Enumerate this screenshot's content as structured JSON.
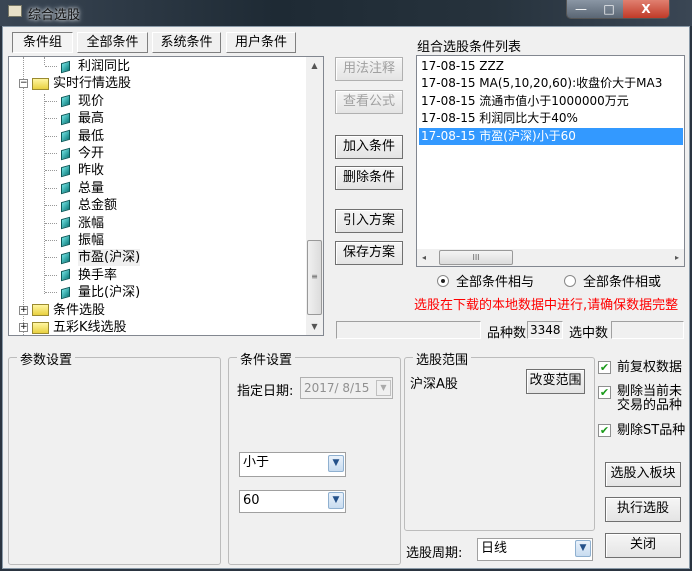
{
  "window": {
    "title": "综合选股",
    "minimize": "—",
    "maximize": "□",
    "close": "X"
  },
  "tabs": [
    {
      "label": "条件组",
      "active": true
    },
    {
      "label": "全部条件"
    },
    {
      "label": "系统条件"
    },
    {
      "label": "用户条件"
    }
  ],
  "tree": {
    "items": [
      {
        "label": "利润同比",
        "type": "leaf"
      },
      {
        "label": "实时行情选股",
        "type": "folder",
        "expanded": true,
        "toggle": "−"
      },
      {
        "label": "现价",
        "type": "leaf"
      },
      {
        "label": "最高",
        "type": "leaf"
      },
      {
        "label": "最低",
        "type": "leaf"
      },
      {
        "label": "今开",
        "type": "leaf"
      },
      {
        "label": "昨收",
        "type": "leaf"
      },
      {
        "label": "总量",
        "type": "leaf"
      },
      {
        "label": "总金额",
        "type": "leaf"
      },
      {
        "label": "涨幅",
        "type": "leaf"
      },
      {
        "label": "振幅",
        "type": "leaf"
      },
      {
        "label": "市盈(沪深)",
        "type": "leaf"
      },
      {
        "label": "换手率",
        "type": "leaf"
      },
      {
        "label": "量比(沪深)",
        "type": "leaf"
      },
      {
        "label": "条件选股",
        "type": "folder",
        "toggle": "+"
      },
      {
        "label": "五彩K线选股",
        "type": "folder",
        "toggle": "+"
      }
    ]
  },
  "actions": {
    "usage_note": "用法注释",
    "view_formula": "查看公式",
    "add_condition": "加入条件",
    "delete_condition": "删除条件",
    "import_plan": "引入方案",
    "save_plan": "保存方案"
  },
  "condition_list": {
    "label": "组合选股条件列表",
    "items": [
      "17-08-15 ZZZ",
      "17-08-15 MA(5,10,20,60):收盘价大于MA3",
      "17-08-15 流通市值小于1000000万元",
      "17-08-15 利润同比大于40%",
      "17-08-15 市盈(沪深)小于60"
    ],
    "selected_index": 4
  },
  "logic": {
    "and_label": "全部条件相与",
    "or_label": "全部条件相或",
    "selected": "and"
  },
  "warning": "选股在下载的本地数据中进行,请确保数据完整",
  "status": {
    "count_label": "品种数",
    "count_value": "3348",
    "selected_label": "选中数",
    "selected_value": ""
  },
  "param_group": {
    "title": "参数设置"
  },
  "cond_group": {
    "title": "条件设置",
    "date_label": "指定日期:",
    "date_value": "2017/ 8/15",
    "operator": "小于",
    "value": "60"
  },
  "scope_group": {
    "title": "选股范围",
    "scope": "沪深A股",
    "change_button": "改变范围"
  },
  "options": [
    {
      "label": "前复权数据",
      "checked": true
    },
    {
      "label": "剔除当前未交易的品种",
      "checked": true
    },
    {
      "label": "剔除ST品种",
      "checked": true
    }
  ],
  "period": {
    "label": "选股周期:",
    "value": "日线"
  },
  "buttons": {
    "to_block": "选股入板块",
    "execute": "执行选股",
    "close": "关闭"
  },
  "colors": {
    "selection": "#3399ff",
    "warning": "#ff0000",
    "check": "#1a9a1a"
  }
}
